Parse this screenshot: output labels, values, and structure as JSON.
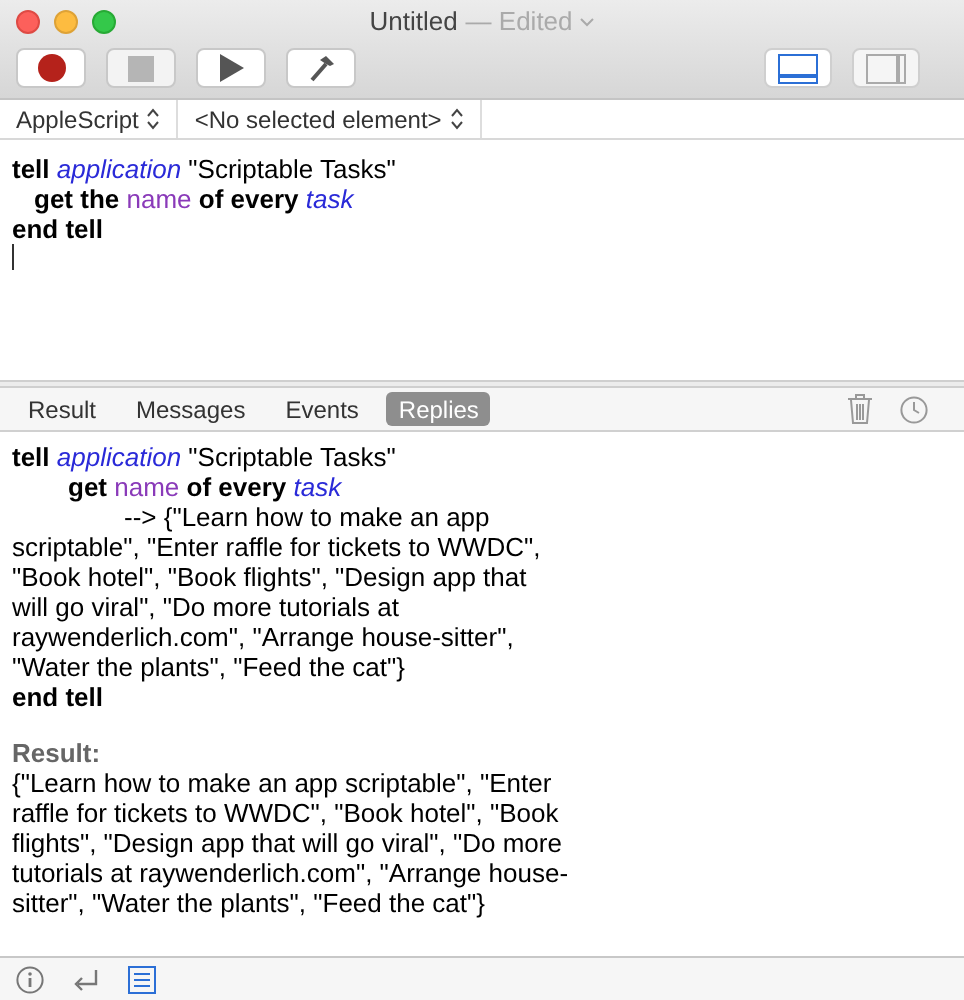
{
  "window": {
    "title": "Untitled",
    "status": "— Edited"
  },
  "toolbar": {
    "buttons": [
      {
        "kind": "record",
        "disabled": false
      },
      {
        "kind": "stop",
        "disabled": true
      },
      {
        "kind": "run",
        "disabled": false
      },
      {
        "kind": "compile",
        "disabled": false
      }
    ],
    "view_toggles": [
      {
        "kind": "bottom",
        "selected": true
      },
      {
        "kind": "side",
        "selected": false
      }
    ]
  },
  "navigation_bar": {
    "language": "AppleScript",
    "element": "<No selected element>"
  },
  "editor": {
    "lines": [
      [
        {
          "text": "tell ",
          "kind": "keyword"
        },
        {
          "text": "application",
          "kind": "class"
        },
        {
          "text": " \"Scriptable Tasks\""
        }
      ],
      [
        {
          "text": "get the ",
          "kind": "keyword"
        },
        {
          "text": "name",
          "kind": "property"
        },
        {
          "text": " of every ",
          "kind": "keyword"
        },
        {
          "text": "task",
          "kind": "class"
        }
      ],
      [
        {
          "text": "end tell",
          "kind": "keyword"
        }
      ]
    ]
  },
  "log_tabs": [
    {
      "label": "Result",
      "selected": false
    },
    {
      "label": "Messages",
      "selected": false
    },
    {
      "label": "Events",
      "selected": false
    },
    {
      "label": "Replies",
      "selected": true
    }
  ],
  "log": {
    "lines": [
      [
        {
          "text": "tell ",
          "kind": "keyword"
        },
        {
          "text": "application",
          "kind": "class"
        },
        {
          "text": " \"Scriptable Tasks\""
        }
      ],
      [
        {
          "text": "get ",
          "kind": "keyword"
        },
        {
          "text": "name",
          "kind": "property"
        },
        {
          "text": " of every ",
          "kind": "keyword"
        },
        {
          "text": "task",
          "kind": "class"
        }
      ]
    ],
    "reply": "--> {\"Learn how to make an app scriptable\", \"Enter raffle for tickets to WWDC\", \"Book hotel\", \"Book flights\", \"Design app that will go viral\", \"Do more tutorials at raywenderlich.com\", \"Arrange house-sitter\", \"Water the plants\", \"Feed the cat\"}",
    "end_line": [
      {
        "text": "end tell",
        "kind": "keyword"
      }
    ],
    "result_label": "Result:",
    "result": "{\"Learn how to make an app scriptable\", \"Enter raffle for tickets to WWDC\", \"Book hotel\", \"Book flights\", \"Design app that will go viral\", \"Do more tutorials at raywenderlich.com\", \"Arrange house-sitter\", \"Water the plants\", \"Feed the cat\"}"
  },
  "bottom_bar": [
    {
      "kind": "info",
      "selected": false
    },
    {
      "kind": "return",
      "selected": false
    },
    {
      "kind": "list",
      "selected": true
    }
  ]
}
